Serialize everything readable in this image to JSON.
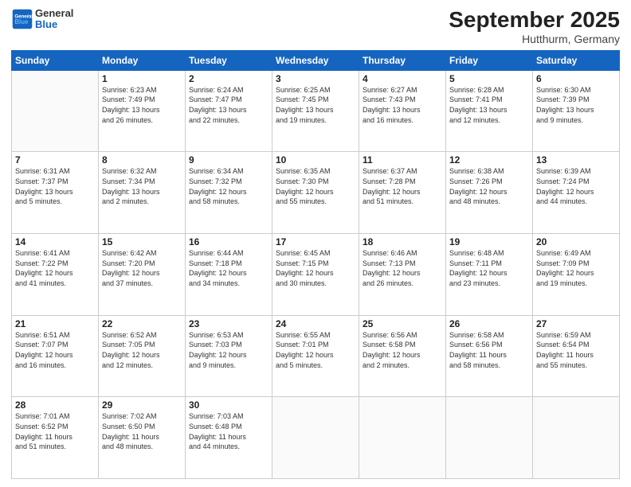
{
  "header": {
    "logo_general": "General",
    "logo_blue": "Blue",
    "month": "September 2025",
    "location": "Hutthurm, Germany"
  },
  "weekdays": [
    "Sunday",
    "Monday",
    "Tuesday",
    "Wednesday",
    "Thursday",
    "Friday",
    "Saturday"
  ],
  "weeks": [
    [
      {
        "day": "",
        "info": ""
      },
      {
        "day": "1",
        "info": "Sunrise: 6:23 AM\nSunset: 7:49 PM\nDaylight: 13 hours\nand 26 minutes."
      },
      {
        "day": "2",
        "info": "Sunrise: 6:24 AM\nSunset: 7:47 PM\nDaylight: 13 hours\nand 22 minutes."
      },
      {
        "day": "3",
        "info": "Sunrise: 6:25 AM\nSunset: 7:45 PM\nDaylight: 13 hours\nand 19 minutes."
      },
      {
        "day": "4",
        "info": "Sunrise: 6:27 AM\nSunset: 7:43 PM\nDaylight: 13 hours\nand 16 minutes."
      },
      {
        "day": "5",
        "info": "Sunrise: 6:28 AM\nSunset: 7:41 PM\nDaylight: 13 hours\nand 12 minutes."
      },
      {
        "day": "6",
        "info": "Sunrise: 6:30 AM\nSunset: 7:39 PM\nDaylight: 13 hours\nand 9 minutes."
      }
    ],
    [
      {
        "day": "7",
        "info": "Sunrise: 6:31 AM\nSunset: 7:37 PM\nDaylight: 13 hours\nand 5 minutes."
      },
      {
        "day": "8",
        "info": "Sunrise: 6:32 AM\nSunset: 7:34 PM\nDaylight: 13 hours\nand 2 minutes."
      },
      {
        "day": "9",
        "info": "Sunrise: 6:34 AM\nSunset: 7:32 PM\nDaylight: 12 hours\nand 58 minutes."
      },
      {
        "day": "10",
        "info": "Sunrise: 6:35 AM\nSunset: 7:30 PM\nDaylight: 12 hours\nand 55 minutes."
      },
      {
        "day": "11",
        "info": "Sunrise: 6:37 AM\nSunset: 7:28 PM\nDaylight: 12 hours\nand 51 minutes."
      },
      {
        "day": "12",
        "info": "Sunrise: 6:38 AM\nSunset: 7:26 PM\nDaylight: 12 hours\nand 48 minutes."
      },
      {
        "day": "13",
        "info": "Sunrise: 6:39 AM\nSunset: 7:24 PM\nDaylight: 12 hours\nand 44 minutes."
      }
    ],
    [
      {
        "day": "14",
        "info": "Sunrise: 6:41 AM\nSunset: 7:22 PM\nDaylight: 12 hours\nand 41 minutes."
      },
      {
        "day": "15",
        "info": "Sunrise: 6:42 AM\nSunset: 7:20 PM\nDaylight: 12 hours\nand 37 minutes."
      },
      {
        "day": "16",
        "info": "Sunrise: 6:44 AM\nSunset: 7:18 PM\nDaylight: 12 hours\nand 34 minutes."
      },
      {
        "day": "17",
        "info": "Sunrise: 6:45 AM\nSunset: 7:15 PM\nDaylight: 12 hours\nand 30 minutes."
      },
      {
        "day": "18",
        "info": "Sunrise: 6:46 AM\nSunset: 7:13 PM\nDaylight: 12 hours\nand 26 minutes."
      },
      {
        "day": "19",
        "info": "Sunrise: 6:48 AM\nSunset: 7:11 PM\nDaylight: 12 hours\nand 23 minutes."
      },
      {
        "day": "20",
        "info": "Sunrise: 6:49 AM\nSunset: 7:09 PM\nDaylight: 12 hours\nand 19 minutes."
      }
    ],
    [
      {
        "day": "21",
        "info": "Sunrise: 6:51 AM\nSunset: 7:07 PM\nDaylight: 12 hours\nand 16 minutes."
      },
      {
        "day": "22",
        "info": "Sunrise: 6:52 AM\nSunset: 7:05 PM\nDaylight: 12 hours\nand 12 minutes."
      },
      {
        "day": "23",
        "info": "Sunrise: 6:53 AM\nSunset: 7:03 PM\nDaylight: 12 hours\nand 9 minutes."
      },
      {
        "day": "24",
        "info": "Sunrise: 6:55 AM\nSunset: 7:01 PM\nDaylight: 12 hours\nand 5 minutes."
      },
      {
        "day": "25",
        "info": "Sunrise: 6:56 AM\nSunset: 6:58 PM\nDaylight: 12 hours\nand 2 minutes."
      },
      {
        "day": "26",
        "info": "Sunrise: 6:58 AM\nSunset: 6:56 PM\nDaylight: 11 hours\nand 58 minutes."
      },
      {
        "day": "27",
        "info": "Sunrise: 6:59 AM\nSunset: 6:54 PM\nDaylight: 11 hours\nand 55 minutes."
      }
    ],
    [
      {
        "day": "28",
        "info": "Sunrise: 7:01 AM\nSunset: 6:52 PM\nDaylight: 11 hours\nand 51 minutes."
      },
      {
        "day": "29",
        "info": "Sunrise: 7:02 AM\nSunset: 6:50 PM\nDaylight: 11 hours\nand 48 minutes."
      },
      {
        "day": "30",
        "info": "Sunrise: 7:03 AM\nSunset: 6:48 PM\nDaylight: 11 hours\nand 44 minutes."
      },
      {
        "day": "",
        "info": ""
      },
      {
        "day": "",
        "info": ""
      },
      {
        "day": "",
        "info": ""
      },
      {
        "day": "",
        "info": ""
      }
    ]
  ]
}
